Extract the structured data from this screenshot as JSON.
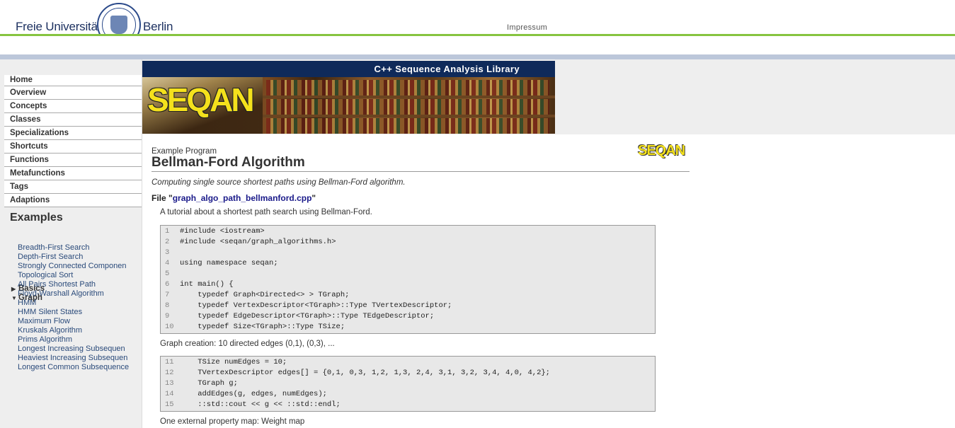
{
  "fu_header": {
    "left_word": "Freie Universität",
    "right_word": "Berlin",
    "impressum": "Impressum"
  },
  "banner": {
    "tagline": "C++ Sequence Analysis Library",
    "logo": "SEQAN"
  },
  "sidebar": {
    "items": [
      {
        "label": "Home"
      },
      {
        "label": "Overview"
      },
      {
        "label": "Concepts"
      },
      {
        "label": "Classes"
      },
      {
        "label": "Specializations"
      },
      {
        "label": "Shortcuts"
      },
      {
        "label": "Functions"
      },
      {
        "label": "Metafunctions"
      },
      {
        "label": "Tags"
      },
      {
        "label": "Adaptions"
      }
    ],
    "examples_heading": "Examples",
    "basics": {
      "label": "Basics",
      "icon": "triangle-right-icon"
    },
    "graph": {
      "label": "Graph",
      "icon": "triangle-down-icon"
    },
    "graph_children": [
      "Breadth-First Search",
      "Depth-First Search",
      "Strongly Connected Componen",
      "Topological Sort",
      "All Pairs Shortest Path",
      "Floyd-Warshall Algorithm",
      "HMM",
      "HMM Silent States",
      "Maximum Flow",
      "Kruskals Algorithm",
      "Prims Algorithm",
      "Longest Increasing Subsequen",
      "Heaviest Increasing Subsequen",
      "Longest Common Subsequence"
    ]
  },
  "main": {
    "example_label": "Example Program",
    "title": "Bellman-Ford Algorithm",
    "small_logo": "SEQAN",
    "subtitle": "Computing single source shortest paths using Bellman-Ford algorithm.",
    "file_prefix": "File \"",
    "file_name": "graph_algo_path_bellmanford.cpp",
    "file_suffix": "\"",
    "desc1": "A tutorial about a shortest path search using Bellman-Ford.",
    "code1": [
      {
        "n": "1",
        "t": "#include <iostream>"
      },
      {
        "n": "2",
        "t": "#include <seqan/graph_algorithms.h>"
      },
      {
        "n": "3",
        "t": ""
      },
      {
        "n": "4",
        "t": "using namespace seqan;"
      },
      {
        "n": "5",
        "t": ""
      },
      {
        "n": "6",
        "t": "int main() {"
      },
      {
        "n": "7",
        "t": "    typedef Graph<Directed<> > TGraph;"
      },
      {
        "n": "8",
        "t": "    typedef VertexDescriptor<TGraph>::Type TVertexDescriptor;"
      },
      {
        "n": "9",
        "t": "    typedef EdgeDescriptor<TGraph>::Type TEdgeDescriptor;"
      },
      {
        "n": "10",
        "t": "    typedef Size<TGraph>::Type TSize;"
      }
    ],
    "desc2": "Graph creation: 10 directed edges (0,1), (0,3), ...",
    "code2": [
      {
        "n": "11",
        "t": "    TSize numEdges = 10;"
      },
      {
        "n": "12",
        "t": "    TVertexDescriptor edges[] = {0,1, 0,3, 1,2, 1,3, 2,4, 3,1, 3,2, 3,4, 4,0, 4,2};"
      },
      {
        "n": "13",
        "t": "    TGraph g;"
      },
      {
        "n": "14",
        "t": "    addEdges(g, edges, numEdges);"
      },
      {
        "n": "15",
        "t": "    ::std::cout << g << ::std::endl;"
      }
    ],
    "desc3": "One external property map: Weight map"
  },
  "colors": {
    "fu_green": "#86c440",
    "fu_blue": "#bcc7da",
    "banner_navy": "#0f2a5a",
    "seqan_yellow": "#f4e11c",
    "link": "#1a1a8a"
  }
}
